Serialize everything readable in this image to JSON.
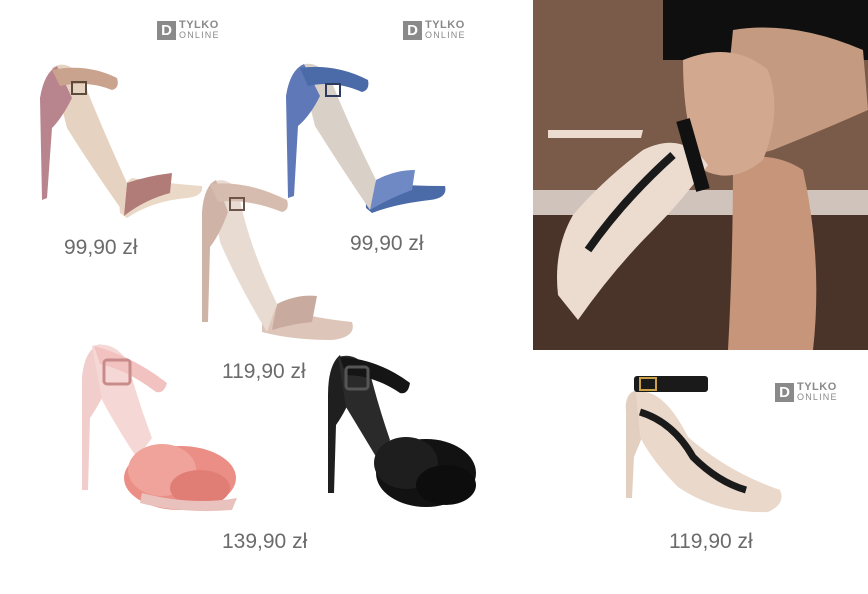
{
  "badges": [
    {
      "letter": "D",
      "line1": "TYLKO",
      "line2": "ONLINE"
    },
    {
      "letter": "D",
      "line1": "TYLKO",
      "line2": "ONLINE"
    },
    {
      "letter": "D",
      "line1": "TYLKO",
      "line2": "ONLINE"
    }
  ],
  "products": [
    {
      "name": "glitter-rose-sandal",
      "price": "99,90 zł",
      "color": "#c99a8e"
    },
    {
      "name": "glitter-blue-sandal",
      "price": "99,90 zł",
      "color": "#5873a8"
    },
    {
      "name": "satin-rose-sandal",
      "price": "119,90 zł",
      "color": "#d9bdb3"
    },
    {
      "name": "pink-feather-sandal",
      "price": "139,90 zł",
      "color": "#e89a94"
    },
    {
      "name": "black-feather-sandal",
      "price": "",
      "color": "#1c1c1c"
    },
    {
      "name": "studded-nude-pump",
      "price": "119,90 zł",
      "color": "#e7d2c3"
    }
  ]
}
